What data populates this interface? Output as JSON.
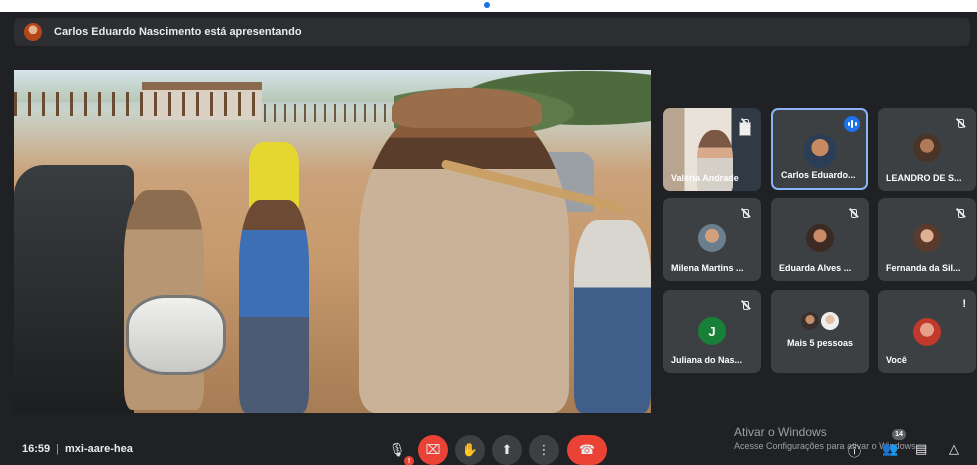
{
  "presenting": {
    "text": "Carlos Eduardo Nascimento está apresentando"
  },
  "participants": [
    {
      "name": "Valéria Andrade",
      "muted": true,
      "video": true
    },
    {
      "name": "Carlos Eduardo...",
      "speaking": true,
      "active": true
    },
    {
      "name": "LEANDRO DE S...",
      "muted": true
    },
    {
      "name": "Milena Martins ...",
      "muted": true
    },
    {
      "name": "Eduarda Alves ...",
      "muted": true
    },
    {
      "name": "Fernanda da Sil...",
      "muted": true
    },
    {
      "name": "Juliana do Nas...",
      "muted": true,
      "initial": "J"
    },
    {
      "name": "Mais 5 pessoas"
    },
    {
      "name": "Você",
      "alert": "!"
    }
  ],
  "footer": {
    "time": "16:59",
    "meeting_code": "mxi-aare-hea",
    "participant_count": "14",
    "mic_alert": "!",
    "watermark_line1": "Ativar o Windows",
    "watermark_line2": "Acesse Configurações para ativar o Windows."
  },
  "colors": {
    "background": "#202124",
    "tile": "#3c4043",
    "accent": "#1a73e8",
    "danger": "#ea4335",
    "active_border": "#8ab4f8"
  },
  "icons": [
    "mic-icon",
    "camera-off-icon",
    "raise-hand-icon",
    "present-screen-icon",
    "more-options-icon",
    "end-call-icon",
    "info-icon",
    "people-icon",
    "chat-icon",
    "activities-icon"
  ]
}
